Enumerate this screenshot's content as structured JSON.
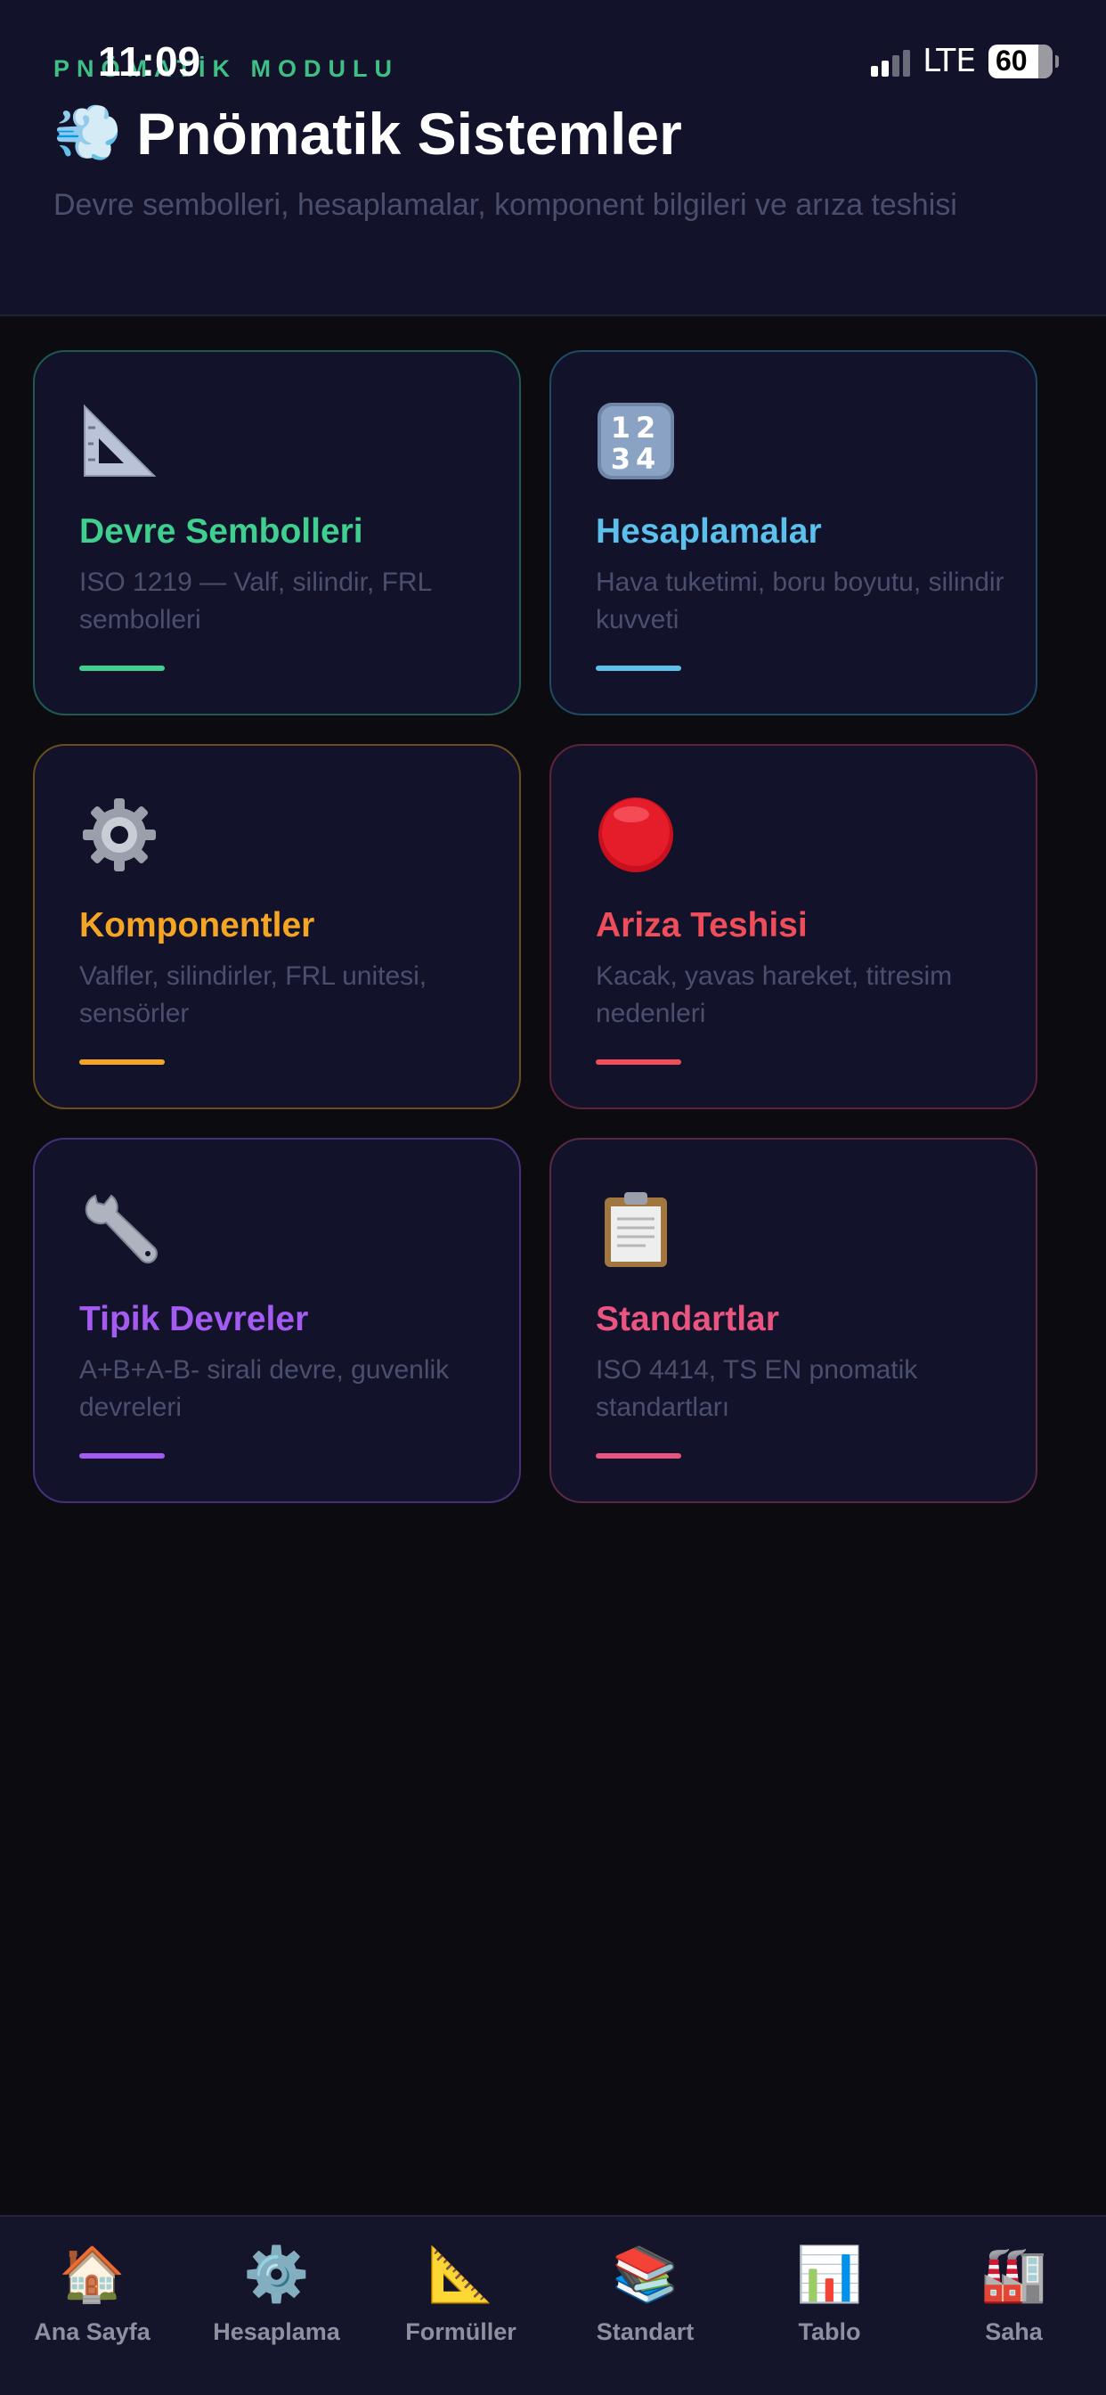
{
  "status_bar": {
    "time": "11:09",
    "network": "LTE",
    "battery": "60"
  },
  "header": {
    "module_label": "PNÖMATİK MODULU",
    "title_icon": "💨",
    "title": "Pnömatik Sistemler",
    "subtitle": "Devre sembolleri, hesaplamalar, komponent bilgileri ve arıza teshisi"
  },
  "cards": [
    {
      "icon": "triangle-ruler-icon",
      "title": "Devre Sembolleri",
      "desc": "ISO 1219 — Valf, silindir, FRL sembolleri",
      "color": "#3fcf8e",
      "border": "#1e5a4e"
    },
    {
      "icon": "numbers-1234-icon",
      "title": "Hesaplamalar",
      "desc": "Hava tuketimi, boru boyutu, silindir kuvveti",
      "color": "#5bc0eb",
      "border": "#1f4a66"
    },
    {
      "icon": "gear-icon",
      "title": "Komponentler",
      "desc": "Valfler, silindirler, FRL unitesi, sensörler",
      "color": "#f5a524",
      "border": "#6a4d1e"
    },
    {
      "icon": "red-circle-icon",
      "title": "Ariza Teshisi",
      "desc": "Kacak, yavas hareket, titresim nedenleri",
      "color": "#ef4d5a",
      "border": "#5e2239"
    },
    {
      "icon": "wrench-icon",
      "title": "Tipik Devreler",
      "desc": "A+B+A-B- sirali devre, guvenlik devreleri",
      "color": "#a45bf2",
      "border": "#45307a"
    },
    {
      "icon": "clipboard-icon",
      "title": "Standartlar",
      "desc": "ISO 4414, TS EN pnomatik standartları",
      "color": "#e9557f",
      "border": "#5a2845"
    }
  ],
  "bottom_nav": [
    {
      "icon": "🏠",
      "label": "Ana Sayfa"
    },
    {
      "icon": "⚙️",
      "label": "Hesaplama"
    },
    {
      "icon": "📐",
      "label": "Formüller"
    },
    {
      "icon": "📚",
      "label": "Standart"
    },
    {
      "icon": "📊",
      "label": "Tablo"
    },
    {
      "icon": "🏭",
      "label": "Saha"
    }
  ]
}
